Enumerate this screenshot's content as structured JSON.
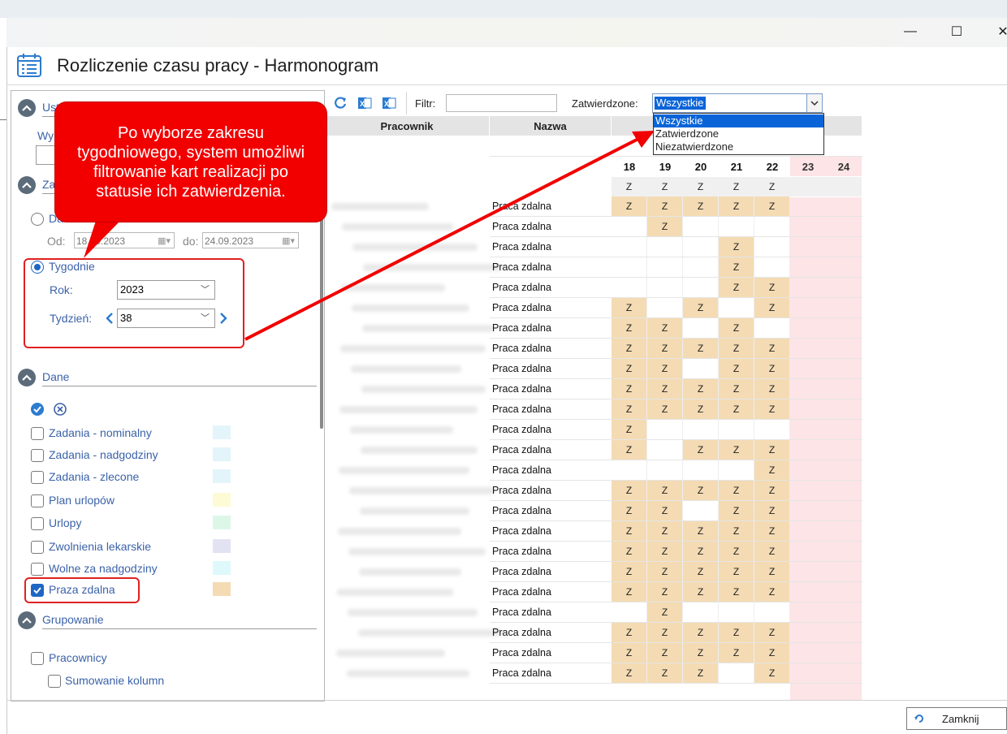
{
  "window": {
    "title": "Rozliczenie czasu pracy - Harmonogram",
    "controls": {
      "minimize": "—",
      "maximize": "☐",
      "close": "✕"
    }
  },
  "left": {
    "ustawienia_label": "Ust",
    "wy_label": "Wy",
    "zakres_label": "Za",
    "daty_label": "Da",
    "od_label": "Od:",
    "od_value": "18.09.2023",
    "do_label": "do:",
    "do_value": "24.09.2023",
    "tygodnie_label": "Tygodnie",
    "rok_label": "Rok:",
    "rok_value": "2023",
    "tydzien_label": "Tydzień:",
    "tydzien_value": "38",
    "dane_label": "Dane",
    "checkboxes": [
      {
        "label": "Zadania - nominalny",
        "color": "#e3f4fb",
        "checked": false
      },
      {
        "label": "Zadania - nadgodziny",
        "color": "#e3f4fb",
        "checked": false
      },
      {
        "label": "Zadania - zlecone",
        "color": "#e3f4fb",
        "checked": false
      },
      {
        "label": "Plan urlopów",
        "color": "#fdfbd6",
        "checked": false
      },
      {
        "label": "Urlopy",
        "color": "#dcf7e8",
        "checked": false
      },
      {
        "label": "Zwolnienia lekarskie",
        "color": "#e2e2f2",
        "checked": false
      },
      {
        "label": "Wolne za nadgodziny",
        "color": "#dff8fb",
        "checked": false
      },
      {
        "label": "Praza zdalna",
        "color": "#f4dbb3",
        "checked": true
      }
    ],
    "grupowanie_label": "Grupowanie",
    "pracownicy_label": "Pracownicy",
    "sumowanie_label": "Sumowanie kolumn"
  },
  "toolbar": {
    "filtr_label": "Filtr:",
    "filtr_value": "",
    "zatwierdzone_label": "Zatwierdzone:",
    "zatwierdzone_value": "Wszystkie",
    "options": [
      "Wszystkie",
      "Zatwierdzone",
      "Niezatwierdzone"
    ]
  },
  "grid": {
    "col_pracownik": "Pracownik",
    "col_nazwa": "Nazwa",
    "days": [
      "18",
      "19",
      "20",
      "21",
      "22",
      "23",
      "24"
    ],
    "summary_row": [
      "Z",
      "Z",
      "Z",
      "Z",
      "Z",
      "",
      ""
    ],
    "work_label": "Praca zdalna",
    "mark": "Z",
    "rows": [
      [
        1,
        1,
        1,
        1,
        1
      ],
      [
        0,
        1,
        0,
        0,
        0
      ],
      [
        0,
        0,
        0,
        1,
        0
      ],
      [
        0,
        0,
        0,
        1,
        0
      ],
      [
        0,
        0,
        0,
        1,
        1
      ],
      [
        1,
        0,
        1,
        0,
        1
      ],
      [
        1,
        1,
        0,
        1,
        0
      ],
      [
        1,
        1,
        1,
        1,
        1
      ],
      [
        1,
        1,
        0,
        1,
        1
      ],
      [
        1,
        1,
        1,
        1,
        1
      ],
      [
        1,
        1,
        1,
        1,
        1
      ],
      [
        1,
        0,
        0,
        0,
        0
      ],
      [
        1,
        0,
        1,
        1,
        1
      ],
      [
        0,
        0,
        0,
        0,
        1
      ],
      [
        1,
        1,
        1,
        1,
        1
      ],
      [
        1,
        1,
        0,
        1,
        1
      ],
      [
        1,
        1,
        1,
        1,
        1
      ],
      [
        1,
        1,
        1,
        1,
        1
      ],
      [
        1,
        1,
        1,
        1,
        1
      ],
      [
        1,
        1,
        1,
        1,
        1
      ],
      [
        0,
        1,
        0,
        0,
        0
      ],
      [
        1,
        1,
        1,
        1,
        1
      ],
      [
        1,
        1,
        1,
        1,
        1
      ],
      [
        1,
        1,
        1,
        0,
        1
      ]
    ],
    "work_color": "#f4dbb3",
    "weekend_color": "#fde4e6"
  },
  "callout": {
    "text": "Po wyborze zakresu tygodniowego, system umożliwi filtrowanie kart realizacji po statusie ich zatwierdzenia."
  },
  "footer": {
    "close_label": "Zamknij"
  }
}
